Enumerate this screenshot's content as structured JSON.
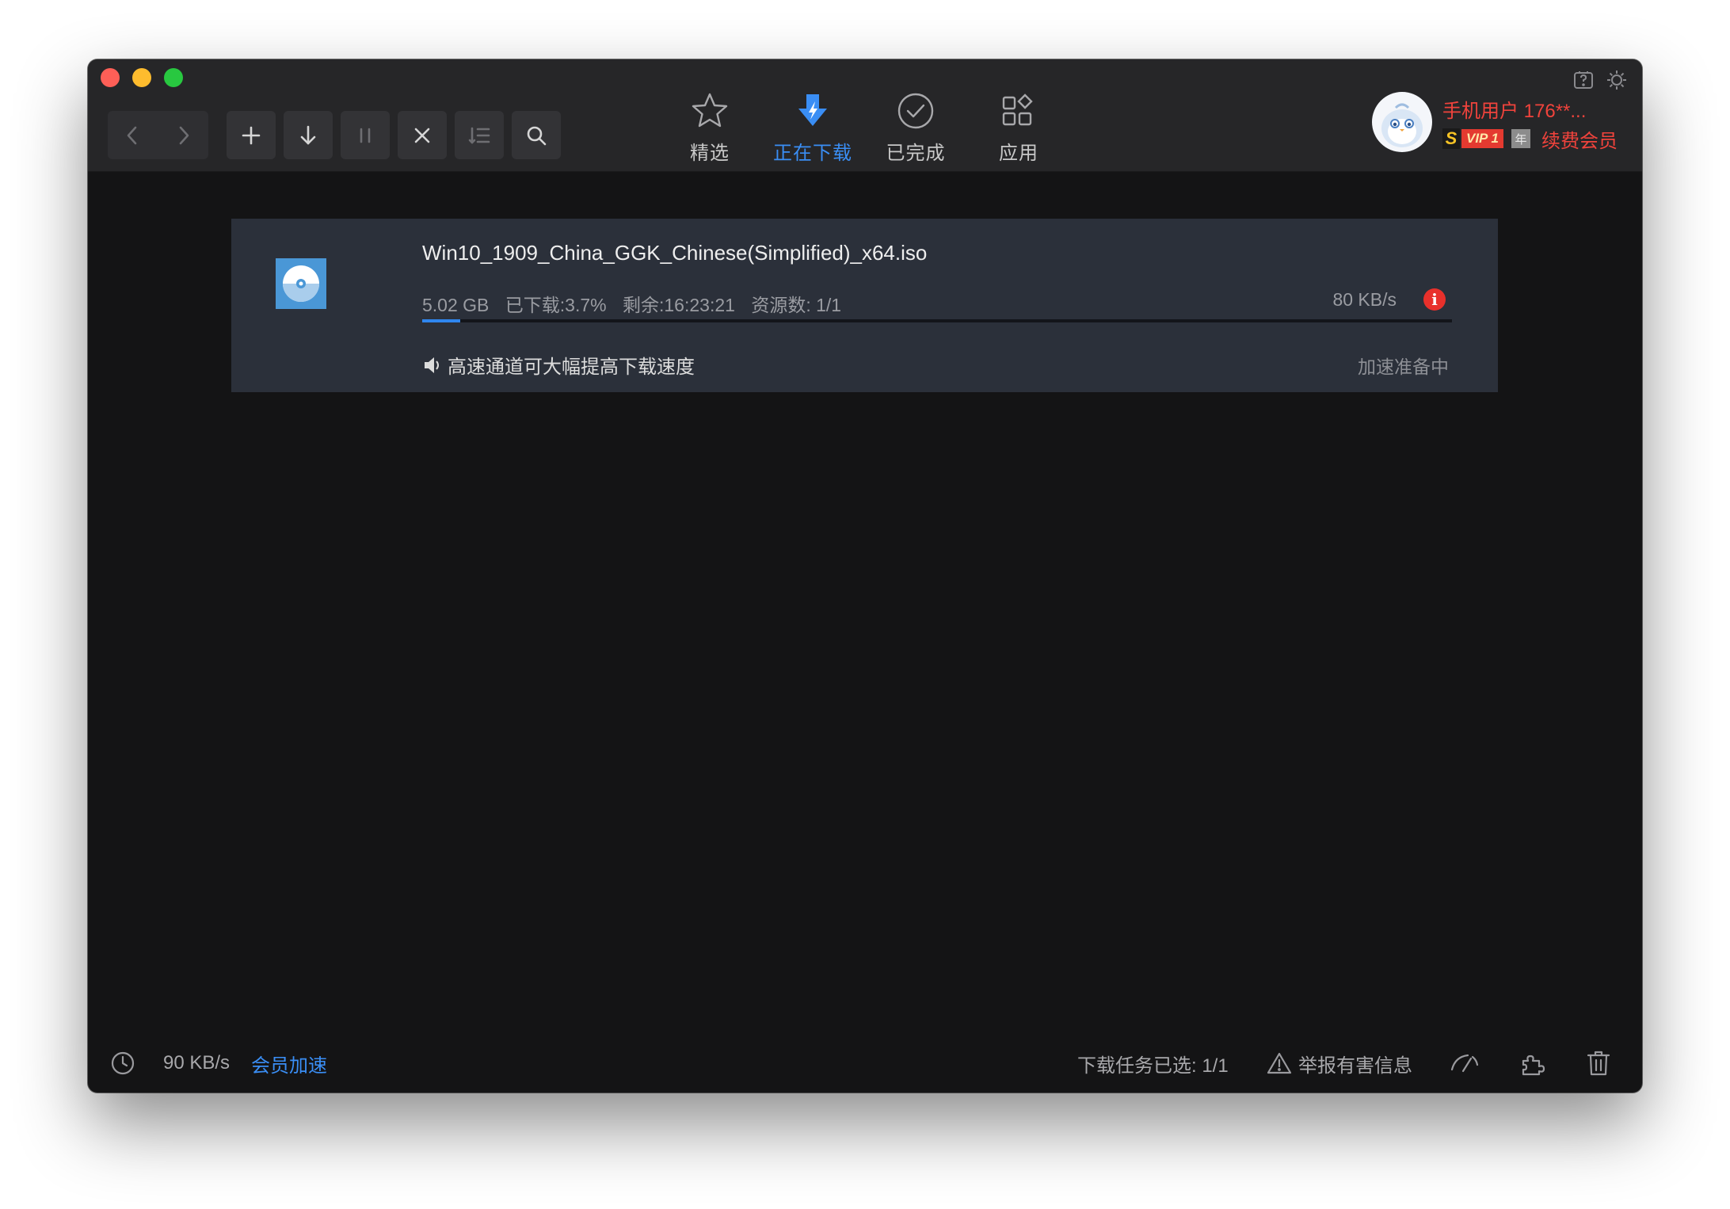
{
  "window": {
    "nav_tabs": [
      {
        "label": "精选",
        "icon": "star-icon",
        "active": false
      },
      {
        "label": "正在下载",
        "icon": "download-bolt-icon",
        "active": true
      },
      {
        "label": "已完成",
        "icon": "check-circle-icon",
        "active": false
      },
      {
        "label": "应用",
        "icon": "apps-grid-icon",
        "active": false
      }
    ],
    "toolbar_icons": [
      "back-icon",
      "forward-icon",
      "add-icon",
      "download-icon",
      "pause-icon",
      "delete-icon",
      "sort-icon",
      "search-icon"
    ]
  },
  "user": {
    "name": "手机用户 176**...",
    "vip_label": "VIP 1",
    "vip_year": "年",
    "renew_label": "续费会员"
  },
  "task": {
    "filename": "Win10_1909_China_GGK_Chinese(Simplified)_x64.iso",
    "size": "5.02 GB",
    "downloaded": "已下载:3.7%",
    "remaining": "剩余:16:23:21",
    "sources": "资源数: 1/1",
    "speed": "80 KB/s",
    "progress_percent": 3.7,
    "promo": "高速通道可大幅提高下载速度",
    "accel_status": "加速准备中"
  },
  "statusbar": {
    "total_speed": "90 KB/s",
    "vip_accel_link": "会员加速",
    "selected_tasks": "下载任务已选: 1/1",
    "report_label": "举报有害信息"
  },
  "colors": {
    "accent": "#3a8ef5",
    "vip_red": "#f0433c",
    "progress": "#2f86ee",
    "background": "#141415",
    "task_card": "#2b303a"
  }
}
